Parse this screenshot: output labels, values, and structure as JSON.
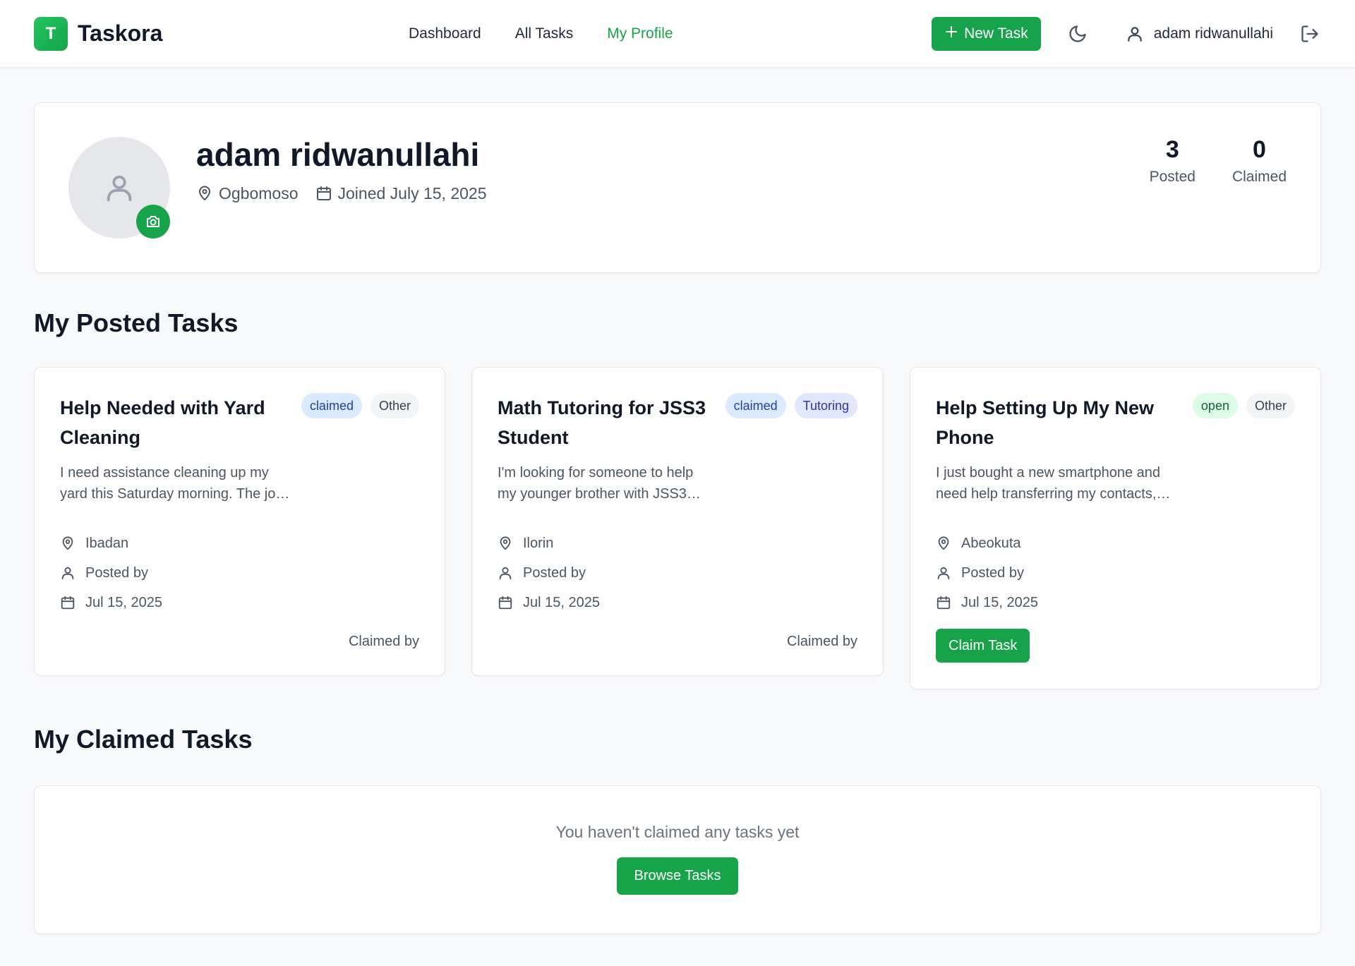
{
  "app": {
    "logo_letter": "T",
    "name": "Taskora",
    "accent_color": "#16a34a"
  },
  "nav": {
    "items": [
      {
        "label": "Dashboard",
        "active": false
      },
      {
        "label": "All Tasks",
        "active": false
      },
      {
        "label": "My Profile",
        "active": true
      }
    ]
  },
  "header": {
    "new_task_label": "New Task",
    "new_task_icon": "plus-icon",
    "theme_icon": "moon-icon",
    "user_icon": "user-icon",
    "user_name": "adam ridwanullahi",
    "logout_icon": "logout-icon"
  },
  "profile": {
    "name": "adam ridwanullahi",
    "location": "Ogbomoso",
    "joined": "Joined July 15, 2025",
    "avatar_icon": "user-icon",
    "camera_icon": "camera-icon",
    "stats": [
      {
        "value": "3",
        "label": "Posted"
      },
      {
        "value": "0",
        "label": "Claimed"
      }
    ]
  },
  "posted": {
    "title": "My Posted Tasks",
    "tasks": [
      {
        "title": "Help Needed with Yard Cleaning",
        "status": "claimed",
        "category": "Other",
        "description_lines": [
          "I need assistance cleaning up my",
          "yard this Saturday morning. The jo…"
        ],
        "location": "Ibadan",
        "posted_by": "Posted by",
        "date": "Jul 15, 2025",
        "footer": "Claimed by"
      },
      {
        "title": "Math Tutoring for JSS3 Student",
        "status": "claimed",
        "category": "Tutoring",
        "description_lines": [
          "I'm looking for someone to help",
          "my younger brother with JSS3…"
        ],
        "location": "Ilorin",
        "posted_by": "Posted by",
        "date": "Jul 15, 2025",
        "footer": "Claimed by"
      },
      {
        "title": "Help Setting Up My New Phone",
        "status": "open",
        "category": "Other",
        "description_lines": [
          "I just bought a new smartphone and",
          "need help transferring my contacts,…"
        ],
        "location": "Abeokuta",
        "posted_by": "Posted by",
        "date": "Jul 15, 2025",
        "action_label": "Claim Task"
      }
    ]
  },
  "claimed": {
    "title": "My Claimed Tasks",
    "empty_text": "You haven't claimed any tasks yet",
    "browse_label": "Browse Tasks"
  }
}
